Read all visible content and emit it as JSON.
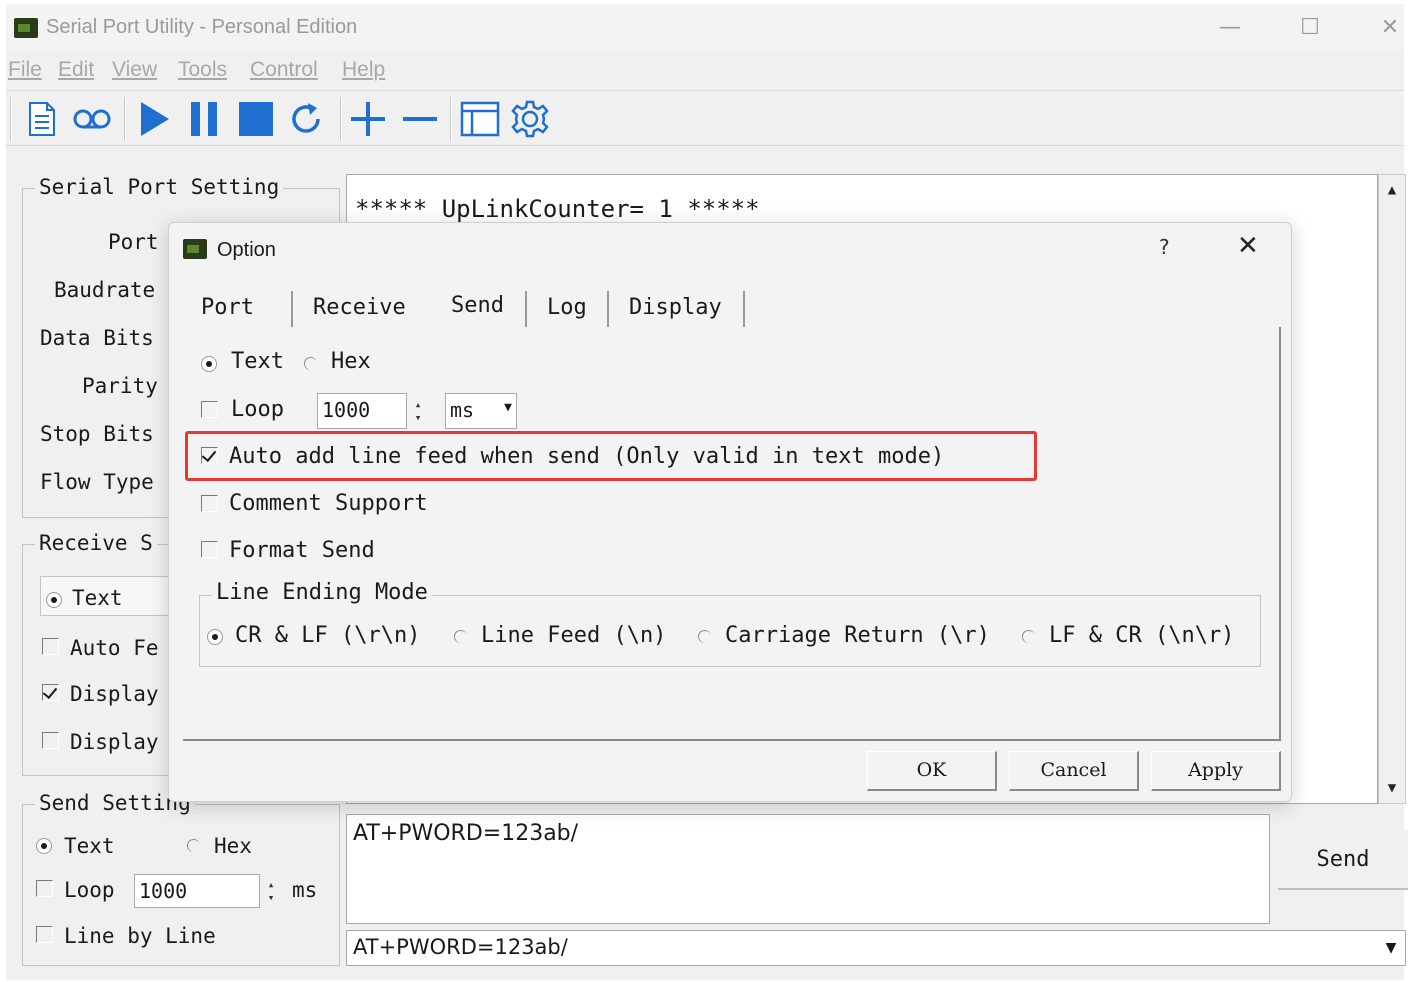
{
  "window": {
    "title": "Serial Port Utility - Personal Edition",
    "controls": {
      "minimize": "—",
      "maximize": "☐",
      "close": "✕"
    }
  },
  "menu": [
    "File",
    "Edit",
    "View",
    "Tools",
    "Control",
    "Help"
  ],
  "toolbar": {
    "icons": [
      "document-icon",
      "loop-icon",
      "play-icon",
      "pause-icon",
      "stop-icon",
      "refresh-icon",
      "add-icon",
      "remove-icon",
      "window-icon",
      "gear-icon"
    ],
    "colors": {
      "accent": "#1e6fd0"
    }
  },
  "serial_port_setting": {
    "title": "Serial Port Setting",
    "labels": [
      "Port",
      "Baudrate",
      "Data Bits",
      "Parity",
      "Stop Bits",
      "Flow Type"
    ]
  },
  "receive_setting": {
    "title": "Receive S",
    "mode_text": "Text",
    "auto_feed": "Auto Fe",
    "display1": "Display",
    "display2": "Display"
  },
  "send_setting": {
    "title": "Send Setting",
    "text_label": "Text",
    "hex_label": "Hex",
    "loop_label": "Loop",
    "loop_value": "1000",
    "loop_unit": "ms",
    "line_by_line": "Line by Line"
  },
  "receive_area": {
    "content": "***** UpLinkCounter= 1 *****"
  },
  "send_area": {
    "content": "AT+PWORD=123ab/",
    "send_button": "Send",
    "history_value": "AT+PWORD=123ab/"
  },
  "option_dialog": {
    "title": "Option",
    "help": "?",
    "close": "✕",
    "tabs": [
      "Port",
      "Receive",
      "Send",
      "Log",
      "Display"
    ],
    "active_tab": "Send",
    "send_tab": {
      "text_label": "Text",
      "hex_label": "Hex",
      "loop_label": "Loop",
      "loop_value": "1000",
      "loop_unit": "ms",
      "auto_line_feed": "Auto add line feed when send (Only valid in text mode)",
      "comment_support": "Comment Support",
      "format_send": "Format Send",
      "line_ending_title": "Line Ending Mode",
      "line_endings": [
        "CR & LF (\\r\\n)",
        "Line Feed (\\n)",
        "Carriage Return (\\r)",
        "LF & CR (\\n\\r)"
      ]
    },
    "buttons": {
      "ok": "OK",
      "cancel": "Cancel",
      "apply": "Apply"
    },
    "highlight_color": "#e53935"
  }
}
